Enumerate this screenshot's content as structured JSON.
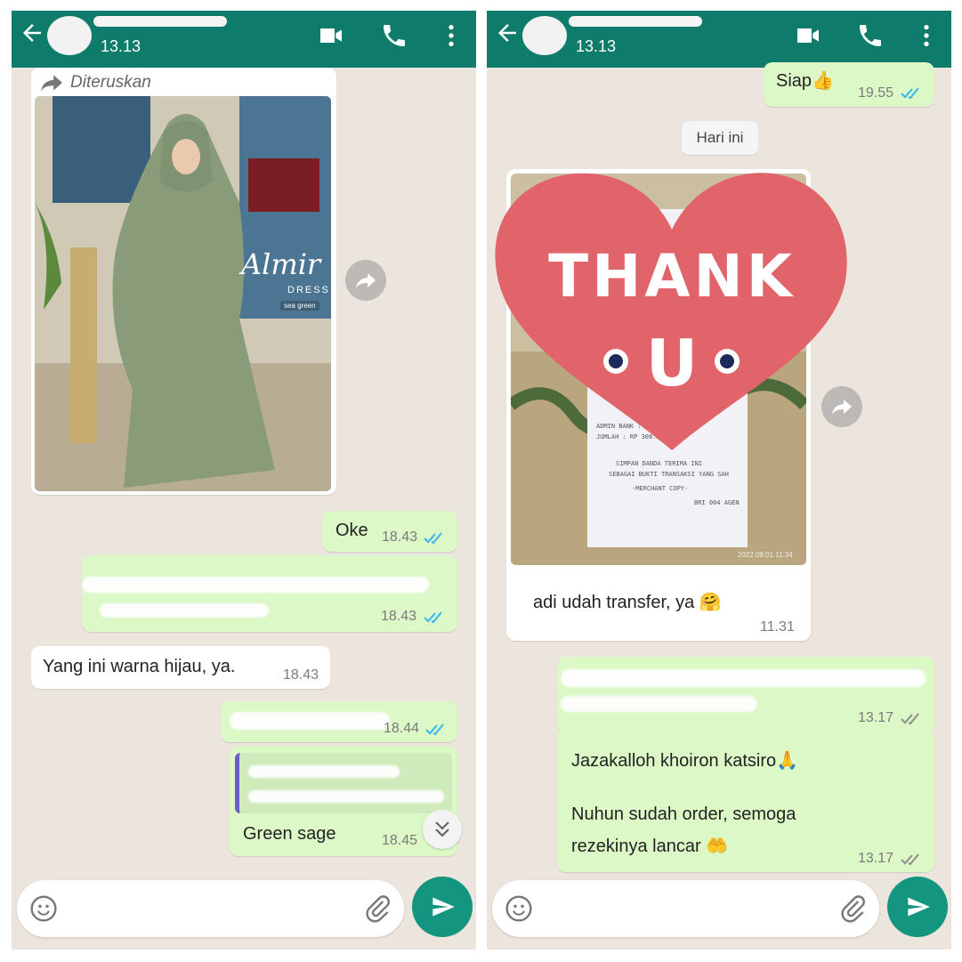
{
  "colors": {
    "header": "#0f7b6b",
    "chat_bg": "#ece5dd",
    "outgoing": "#dcf8c6",
    "incoming": "#ffffff",
    "read_ticks": "#34b7f1",
    "send": "#13957f"
  },
  "left": {
    "header": {
      "time": "13.13"
    },
    "forwarded_label": "Diteruskan",
    "image_caption": {
      "brand": "Almir",
      "sub": "DRESS",
      "tag": "sea green"
    },
    "messages": [
      {
        "text": "Oke",
        "time": "18.43"
      },
      {
        "text": "",
        "time": "18.43"
      },
      {
        "text": "Yang ini warna hijau, ya.",
        "time": "18.43"
      },
      {
        "text": "",
        "time": "18.44"
      },
      {
        "text": "Green sage",
        "time": "18.45"
      }
    ]
  },
  "right": {
    "header": {
      "time": "13.13"
    },
    "messages": [
      {
        "text": "Siap👍",
        "time": "19.55"
      },
      {
        "text": "adi udah transfer, ya 🤗",
        "time": "11.31"
      },
      {
        "text": "",
        "time": "13.17"
      },
      {
        "line1": "Jazakalloh khoiron katsiro🙏",
        "line2": "Nuhun sudah order, semoga",
        "line3": "rezekinya lancar 🤲",
        "time": "13.17"
      }
    ],
    "date_divider": "Hari ini",
    "sticker_text": {
      "line1": "THANK",
      "line2": "U"
    },
    "receipt_date": "2022.08.01 11:34"
  },
  "icons": [
    "back-arrow-icon",
    "video-call-icon",
    "phone-icon",
    "more-vert-icon",
    "forward-icon",
    "emoji-icon",
    "attach-icon",
    "send-icon",
    "scroll-down-icon",
    "double-check-icon"
  ]
}
